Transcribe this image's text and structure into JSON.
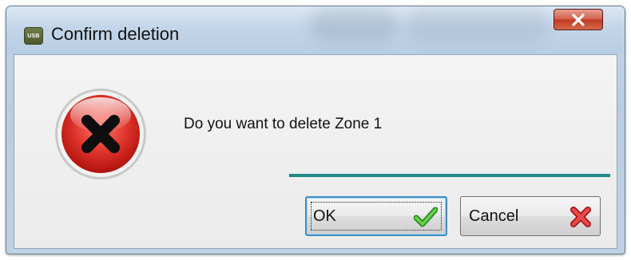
{
  "window": {
    "title": "Confirm deletion",
    "app_icon_text": "USB",
    "close_icon": "close-icon"
  },
  "dialog": {
    "icon": "error-icon",
    "message": "Do you want to delete Zone 1",
    "accent_color": "#1f8a8a"
  },
  "buttons": {
    "ok_label": "OK",
    "ok_icon": "checkmark-icon",
    "cancel_label": "Cancel",
    "cancel_icon": "red-x-icon"
  },
  "colors": {
    "error_red": "#d4201d",
    "close_red": "#c84a33",
    "ok_focus_border": "#3c8fc4",
    "check_green": "#3aa82e"
  }
}
